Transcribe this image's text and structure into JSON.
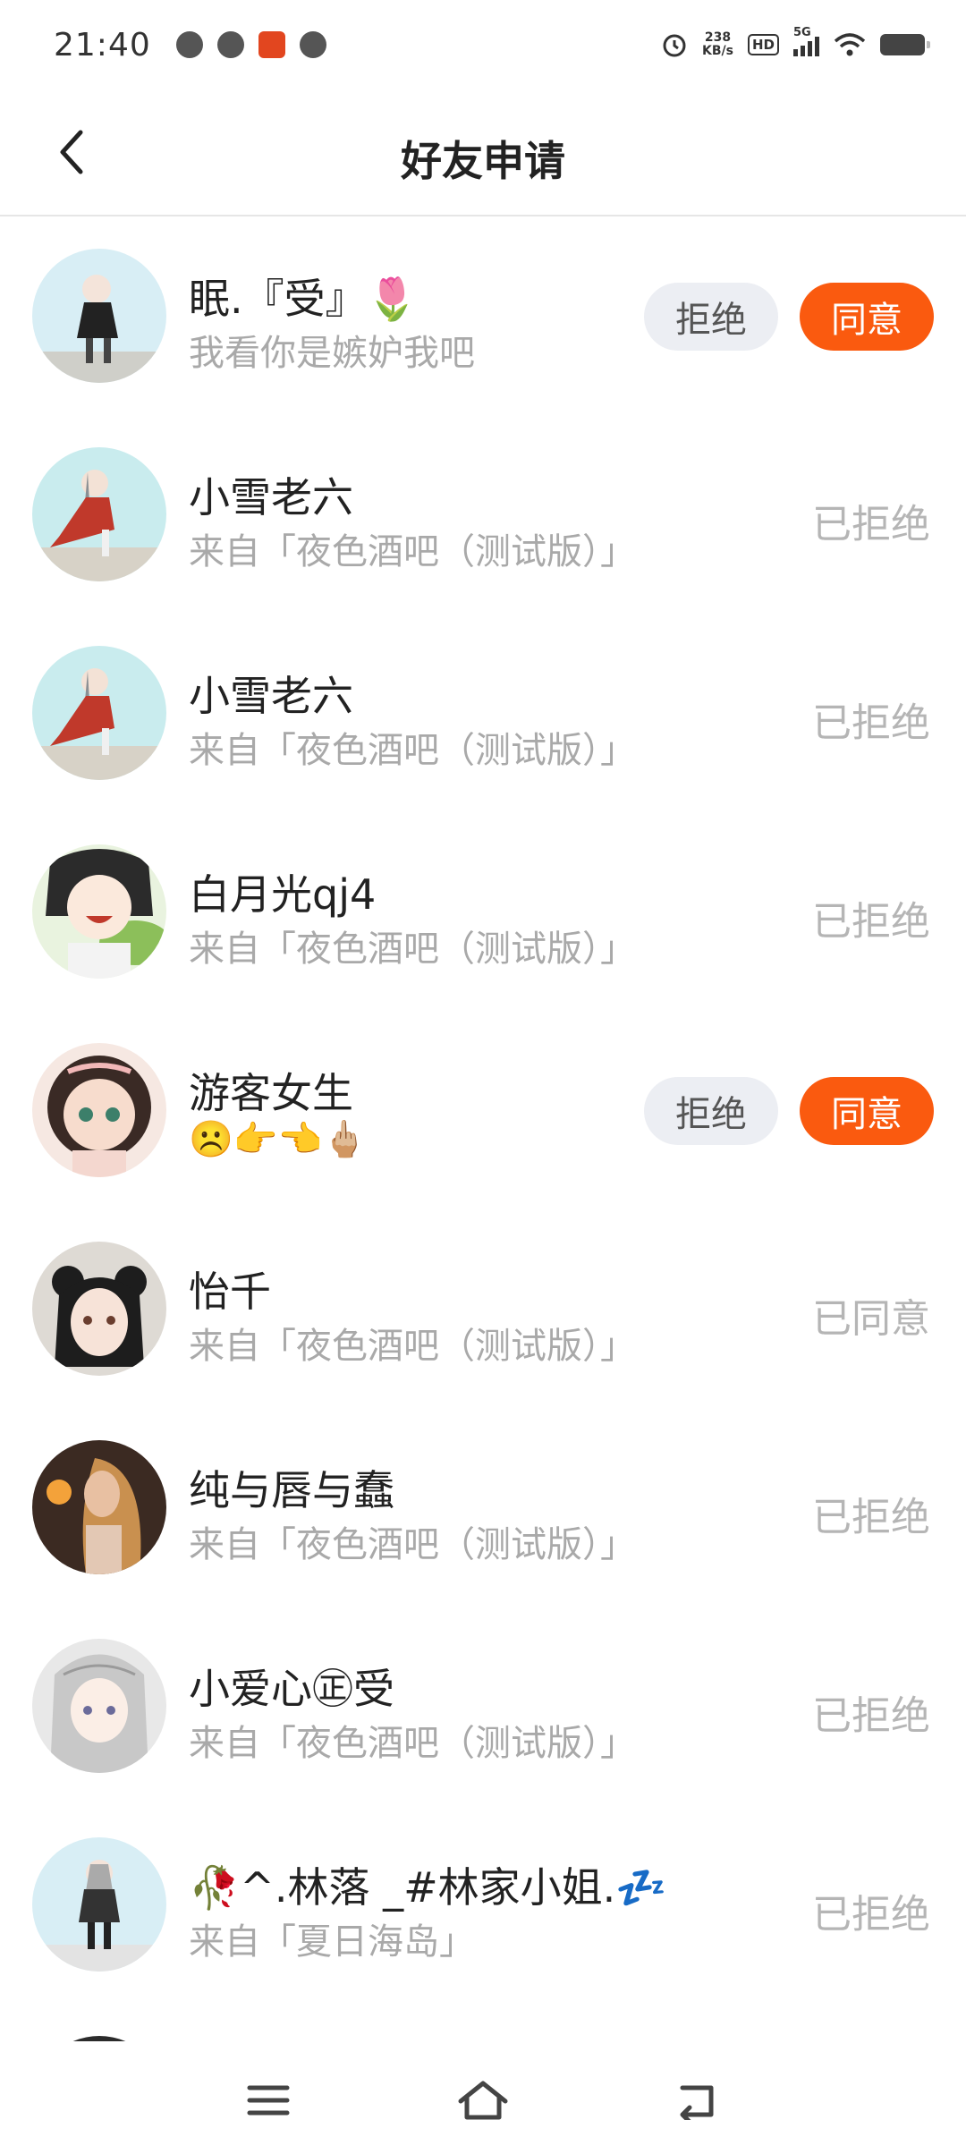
{
  "status_bar": {
    "time": "21:40",
    "speed_value": "238",
    "speed_unit": "KB/s",
    "hd": "HD",
    "network": "5G"
  },
  "header": {
    "title": "好友申请",
    "back_icon": "chevron-left-icon"
  },
  "requests": [
    {
      "name": "眠.『受』🌷",
      "subtitle": "我看你是嫉妒我吧",
      "state": "pending",
      "status_text": "",
      "avatar_colors": [
        "#d8eef5",
        "#c9c9c9"
      ]
    },
    {
      "name": "小雪老六",
      "subtitle": "来自「夜色酒吧（测试版）」",
      "state": "done",
      "status_text": "已拒绝",
      "avatar_colors": [
        "#c9ecee",
        "#c0392b"
      ]
    },
    {
      "name": "小雪老六",
      "subtitle": "来自「夜色酒吧（测试版）」",
      "state": "done",
      "status_text": "已拒绝",
      "avatar_colors": [
        "#c9ecee",
        "#c0392b"
      ]
    },
    {
      "name": "白月光qj4",
      "subtitle": "来自「夜色酒吧（测试版）」",
      "state": "done",
      "status_text": "已拒绝",
      "avatar_colors": [
        "#bfe0a0",
        "#2b2b2b"
      ]
    },
    {
      "name": "游客女生",
      "subtitle": "☹️👉👈🖕🏼",
      "state": "pending",
      "status_text": "",
      "avatar_colors": [
        "#f3d9cf",
        "#3a2a25"
      ]
    },
    {
      "name": "怡千",
      "subtitle": "来自「夜色酒吧（测试版）」",
      "state": "done",
      "status_text": "已同意",
      "avatar_colors": [
        "#dedad4",
        "#1d1d1d"
      ]
    },
    {
      "name": "纯与唇与蠢",
      "subtitle": "来自「夜色酒吧（测试版）」",
      "state": "done",
      "status_text": "已拒绝",
      "avatar_colors": [
        "#5a3a2a",
        "#d9a36a"
      ]
    },
    {
      "name": "小爱心㊣受",
      "subtitle": "来自「夜色酒吧（测试版）」",
      "state": "done",
      "status_text": "已拒绝",
      "avatar_colors": [
        "#e6e6e6",
        "#9a9a9a"
      ]
    },
    {
      "name": "🥀^.林落 _#林家小姐.💤",
      "subtitle": "来自「夏日海岛」",
      "state": "done",
      "status_text": "已拒绝",
      "avatar_colors": [
        "#d8eef5",
        "#333333"
      ]
    }
  ],
  "buttons": {
    "reject": "拒绝",
    "accept": "同意"
  },
  "nav": {
    "menu_icon": "menu-icon",
    "home_icon": "home-icon",
    "back_icon": "back-arrow-icon"
  },
  "colors": {
    "accent": "#fa5a0f",
    "reject_bg": "#eceef3",
    "muted_text": "#a9a9a9"
  }
}
